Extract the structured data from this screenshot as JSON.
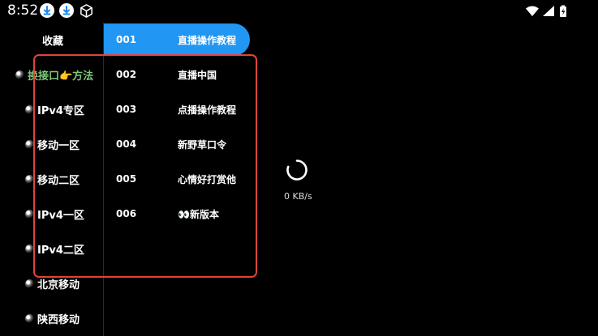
{
  "status_bar": {
    "time": "8:52",
    "icons": [
      "download-icon",
      "download-icon",
      "cube-icon",
      "wifi-icon",
      "signal-icon",
      "battery-icon"
    ]
  },
  "categories": [
    {
      "label": "收藏",
      "has_icon": false
    },
    {
      "label": "换接口👉方法",
      "has_icon": true,
      "active": true
    },
    {
      "label": "IPv4专区",
      "has_icon": true
    },
    {
      "label": "移动一区",
      "has_icon": true
    },
    {
      "label": "移动二区",
      "has_icon": true
    },
    {
      "label": "IPv4一区",
      "has_icon": true
    },
    {
      "label": "IPv4二区",
      "has_icon": true
    },
    {
      "label": "北京移动",
      "has_icon": true
    },
    {
      "label": "陕西移动",
      "has_icon": true
    }
  ],
  "channels": [
    {
      "num": "001",
      "name": "直播操作教程",
      "selected": true
    },
    {
      "num": "002",
      "name": "直播中国"
    },
    {
      "num": "003",
      "name": "点播操作教程"
    },
    {
      "num": "004",
      "name": "新野草口令"
    },
    {
      "num": "005",
      "name": "心情好打赏他"
    },
    {
      "num": "006",
      "name": "👀新版本"
    }
  ],
  "player": {
    "speed": "0 KB/s"
  },
  "colors": {
    "accent": "#2196f3",
    "active_category": "#7ec87a",
    "highlight": "#e0453a"
  }
}
